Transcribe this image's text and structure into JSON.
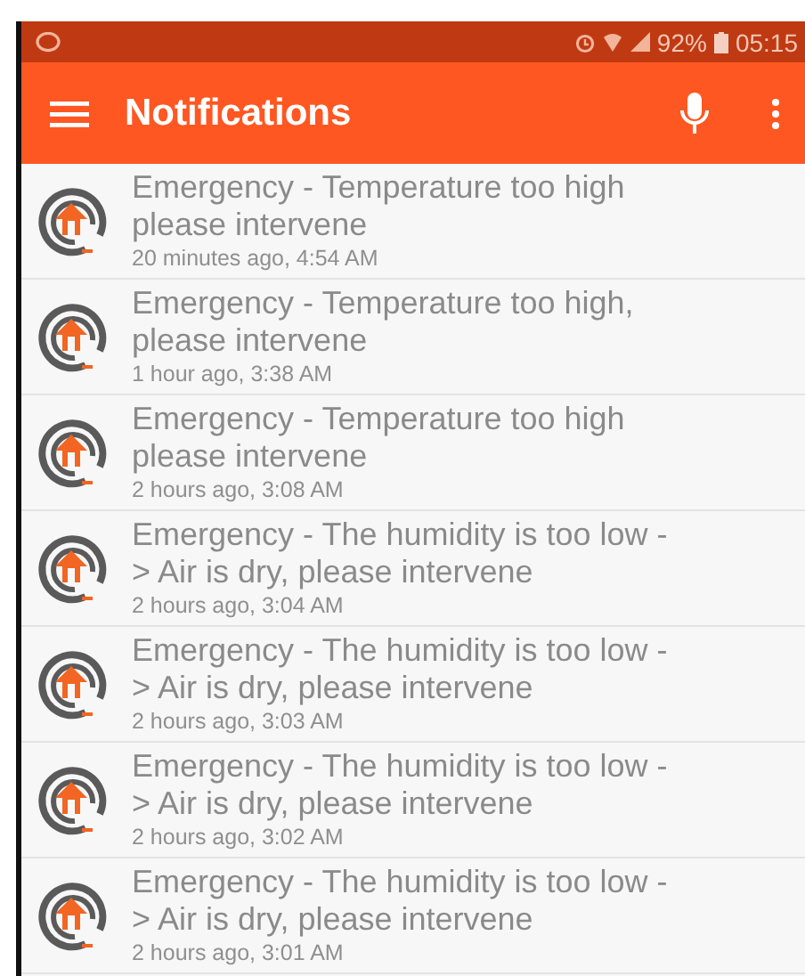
{
  "status_bar": {
    "battery": "92%",
    "time": "05:15"
  },
  "app_bar": {
    "title": "Notifications"
  },
  "notifications": [
    {
      "title": "Emergency - Temperature too high\nplease intervene",
      "time": "20 minutes ago, 4:54 AM"
    },
    {
      "title": "Emergency - Temperature too high,\nplease intervene",
      "time": "1 hour ago, 3:38 AM"
    },
    {
      "title": "Emergency - Temperature too high\nplease intervene",
      "time": "2 hours ago, 3:08 AM"
    },
    {
      "title": "Emergency - The humidity is too low -\n> Air is dry, please intervene",
      "time": "2 hours ago, 3:04 AM"
    },
    {
      "title": "Emergency - The humidity is too low -\n> Air is dry, please intervene",
      "time": "2 hours ago, 3:03 AM"
    },
    {
      "title": "Emergency - The humidity is too low -\n> Air is dry, please intervene",
      "time": "2 hours ago, 3:02 AM"
    },
    {
      "title": "Emergency - The humidity is too low -\n> Air is dry, please intervene",
      "time": "2 hours ago, 3:01 AM"
    }
  ]
}
